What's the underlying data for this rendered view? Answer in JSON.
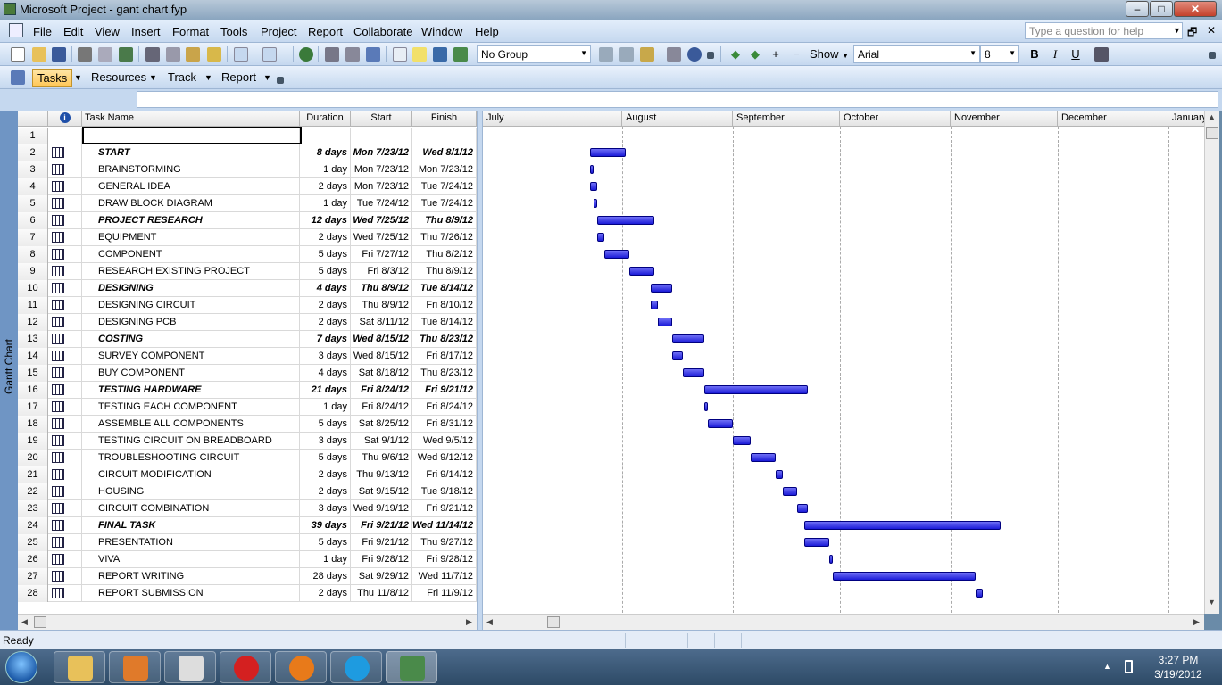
{
  "window": {
    "title": "Microsoft Project - gant chart fyp"
  },
  "menu": [
    "File",
    "Edit",
    "View",
    "Insert",
    "Format",
    "Tools",
    "Project",
    "Report",
    "Collaborate",
    "Window",
    "Help"
  ],
  "help_box": {
    "placeholder": "Type a question for help"
  },
  "toolbar": {
    "group_value": "No Group",
    "show_label": "Show",
    "font_value": "Arial",
    "size_value": "8",
    "bold": "B",
    "italic": "I",
    "underline": "U"
  },
  "guide_toolbar": {
    "tasks": "Tasks",
    "resources": "Resources",
    "track": "Track",
    "report": "Report"
  },
  "view_bar": {
    "label": "Gantt Chart"
  },
  "columns": {
    "info": "i",
    "name": "Task Name",
    "duration": "Duration",
    "start": "Start",
    "finish": "Finish"
  },
  "months": [
    "July",
    "August",
    "September",
    "October",
    "November",
    "December",
    "January"
  ],
  "tasks": [
    {
      "id": "1",
      "name": "",
      "duration": "",
      "start": "",
      "finish": "",
      "summary": false,
      "icon": false
    },
    {
      "id": "2",
      "name": "START",
      "duration": "8 days",
      "start": "Mon 7/23/12",
      "finish": "Wed 8/1/12",
      "summary": true,
      "icon": true
    },
    {
      "id": "3",
      "name": "BRAINSTORMING",
      "duration": "1 day",
      "start": "Mon 7/23/12",
      "finish": "Mon 7/23/12",
      "summary": false,
      "icon": true
    },
    {
      "id": "4",
      "name": "GENERAL IDEA",
      "duration": "2 days",
      "start": "Mon 7/23/12",
      "finish": "Tue 7/24/12",
      "summary": false,
      "icon": true
    },
    {
      "id": "5",
      "name": "DRAW BLOCK DIAGRAM",
      "duration": "1 day",
      "start": "Tue 7/24/12",
      "finish": "Tue 7/24/12",
      "summary": false,
      "icon": true
    },
    {
      "id": "6",
      "name": "PROJECT RESEARCH",
      "duration": "12 days",
      "start": "Wed 7/25/12",
      "finish": "Thu 8/9/12",
      "summary": true,
      "icon": true
    },
    {
      "id": "7",
      "name": "EQUIPMENT",
      "duration": "2 days",
      "start": "Wed 7/25/12",
      "finish": "Thu 7/26/12",
      "summary": false,
      "icon": true
    },
    {
      "id": "8",
      "name": "COMPONENT",
      "duration": "5 days",
      "start": "Fri 7/27/12",
      "finish": "Thu 8/2/12",
      "summary": false,
      "icon": true
    },
    {
      "id": "9",
      "name": "RESEARCH EXISTING PROJECT",
      "duration": "5 days",
      "start": "Fri 8/3/12",
      "finish": "Thu 8/9/12",
      "summary": false,
      "icon": true
    },
    {
      "id": "10",
      "name": "DESIGNING",
      "duration": "4 days",
      "start": "Thu 8/9/12",
      "finish": "Tue 8/14/12",
      "summary": true,
      "icon": true
    },
    {
      "id": "11",
      "name": "DESIGNING CIRCUIT",
      "duration": "2 days",
      "start": "Thu 8/9/12",
      "finish": "Fri 8/10/12",
      "summary": false,
      "icon": true
    },
    {
      "id": "12",
      "name": "DESIGNING PCB",
      "duration": "2 days",
      "start": "Sat 8/11/12",
      "finish": "Tue 8/14/12",
      "summary": false,
      "icon": true
    },
    {
      "id": "13",
      "name": "COSTING",
      "duration": "7 days",
      "start": "Wed 8/15/12",
      "finish": "Thu 8/23/12",
      "summary": true,
      "icon": true
    },
    {
      "id": "14",
      "name": "SURVEY COMPONENT",
      "duration": "3 days",
      "start": "Wed 8/15/12",
      "finish": "Fri 8/17/12",
      "summary": false,
      "icon": true
    },
    {
      "id": "15",
      "name": "BUY COMPONENT",
      "duration": "4 days",
      "start": "Sat 8/18/12",
      "finish": "Thu 8/23/12",
      "summary": false,
      "icon": true
    },
    {
      "id": "16",
      "name": "TESTING HARDWARE",
      "duration": "21 days",
      "start": "Fri 8/24/12",
      "finish": "Fri 9/21/12",
      "summary": true,
      "icon": true
    },
    {
      "id": "17",
      "name": "TESTING EACH COMPONENT",
      "duration": "1 day",
      "start": "Fri 8/24/12",
      "finish": "Fri 8/24/12",
      "summary": false,
      "icon": true
    },
    {
      "id": "18",
      "name": "ASSEMBLE ALL COMPONENTS",
      "duration": "5 days",
      "start": "Sat 8/25/12",
      "finish": "Fri 8/31/12",
      "summary": false,
      "icon": true
    },
    {
      "id": "19",
      "name": "TESTING CIRCUIT ON BREADBOARD",
      "duration": "3 days",
      "start": "Sat 9/1/12",
      "finish": "Wed 9/5/12",
      "summary": false,
      "icon": true
    },
    {
      "id": "20",
      "name": "TROUBLESHOOTING CIRCUIT",
      "duration": "5 days",
      "start": "Thu 9/6/12",
      "finish": "Wed 9/12/12",
      "summary": false,
      "icon": true
    },
    {
      "id": "21",
      "name": "CIRCUIT MODIFICATION",
      "duration": "2 days",
      "start": "Thu 9/13/12",
      "finish": "Fri 9/14/12",
      "summary": false,
      "icon": true
    },
    {
      "id": "22",
      "name": "HOUSING",
      "duration": "2 days",
      "start": "Sat 9/15/12",
      "finish": "Tue 9/18/12",
      "summary": false,
      "icon": true
    },
    {
      "id": "23",
      "name": "CIRCUIT COMBINATION",
      "duration": "3 days",
      "start": "Wed 9/19/12",
      "finish": "Fri 9/21/12",
      "summary": false,
      "icon": true
    },
    {
      "id": "24",
      "name": "FINAL TASK",
      "duration": "39 days",
      "start": "Fri 9/21/12",
      "finish": "Wed 11/14/12",
      "summary": true,
      "icon": true
    },
    {
      "id": "25",
      "name": "PRESENTATION",
      "duration": "5 days",
      "start": "Fri 9/21/12",
      "finish": "Thu 9/27/12",
      "summary": false,
      "icon": true
    },
    {
      "id": "26",
      "name": "VIVA",
      "duration": "1 day",
      "start": "Fri 9/28/12",
      "finish": "Fri 9/28/12",
      "summary": false,
      "icon": true
    },
    {
      "id": "27",
      "name": "REPORT WRITING",
      "duration": "28 days",
      "start": "Sat 9/29/12",
      "finish": "Wed 11/7/12",
      "summary": false,
      "icon": true
    },
    {
      "id": "28",
      "name": "REPORT SUBMISSION",
      "duration": "2 days",
      "start": "Thu 11/8/12",
      "finish": "Fri 11/9/12",
      "summary": false,
      "icon": true
    }
  ],
  "status": {
    "text": "Ready"
  },
  "taskbar": {
    "apps": [
      "windows-explorer",
      "media-player",
      "alien-app",
      "opera",
      "firefox",
      "skype",
      "microsoft-project"
    ],
    "time": "3:27 PM",
    "date": "3/19/2012"
  },
  "colors": {
    "gantt_bar": "#2a2ae0",
    "selected_tab": "#ffc85a",
    "toolbar_bg": "#c5d8ef"
  }
}
